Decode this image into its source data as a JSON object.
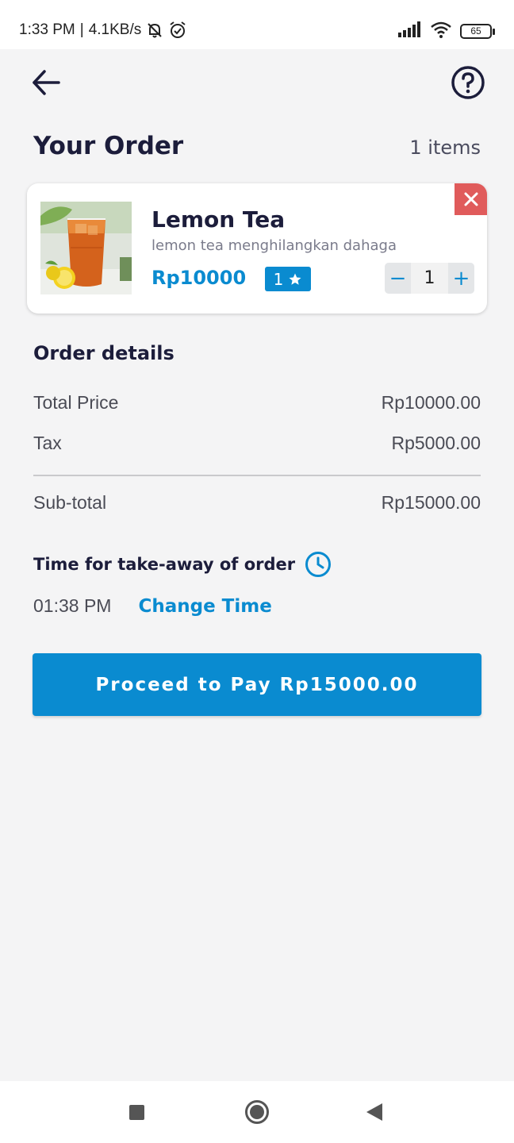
{
  "status_bar": {
    "time": "1:33 PM",
    "separator": "|",
    "network_speed": "4.1KB/s",
    "battery": "65",
    "icons": [
      "muted-bell-icon",
      "alarm-icon",
      "signal-icon",
      "wifi-icon",
      "battery-icon"
    ]
  },
  "header": {
    "back_icon": "arrow-left-icon",
    "help_icon": "question-circle-icon"
  },
  "order": {
    "title": "Your Order",
    "item_count": "1 items"
  },
  "items": [
    {
      "name": "Lemon Tea",
      "description": "lemon tea menghilangkan dahaga",
      "price": "Rp10000",
      "rating": "1",
      "rating_icon": "star-icon",
      "quantity": "1",
      "minus_label": "−",
      "plus_label": "+",
      "remove_icon": "close-icon"
    }
  ],
  "details": {
    "title": "Order details",
    "total_label": "Total Price",
    "total_value": "Rp10000.00",
    "tax_label": "Tax",
    "tax_value": "Rp5000.00",
    "subtotal_label": "Sub-total",
    "subtotal_value": "Rp15000.00"
  },
  "takeaway": {
    "title": "Time for take-away of order",
    "icon": "clock-icon",
    "time": "01:38 PM",
    "change_label": "Change Time"
  },
  "pay_button": {
    "label": "Proceed to Pay Rp15000.00"
  },
  "nav": {
    "icons": [
      "recents-square-icon",
      "home-circle-icon",
      "back-triangle-icon"
    ]
  },
  "colors": {
    "accent": "#0a8bd0",
    "danger": "#e05b5b",
    "text_dark": "#1c1d3b",
    "background": "#f4f4f5"
  }
}
